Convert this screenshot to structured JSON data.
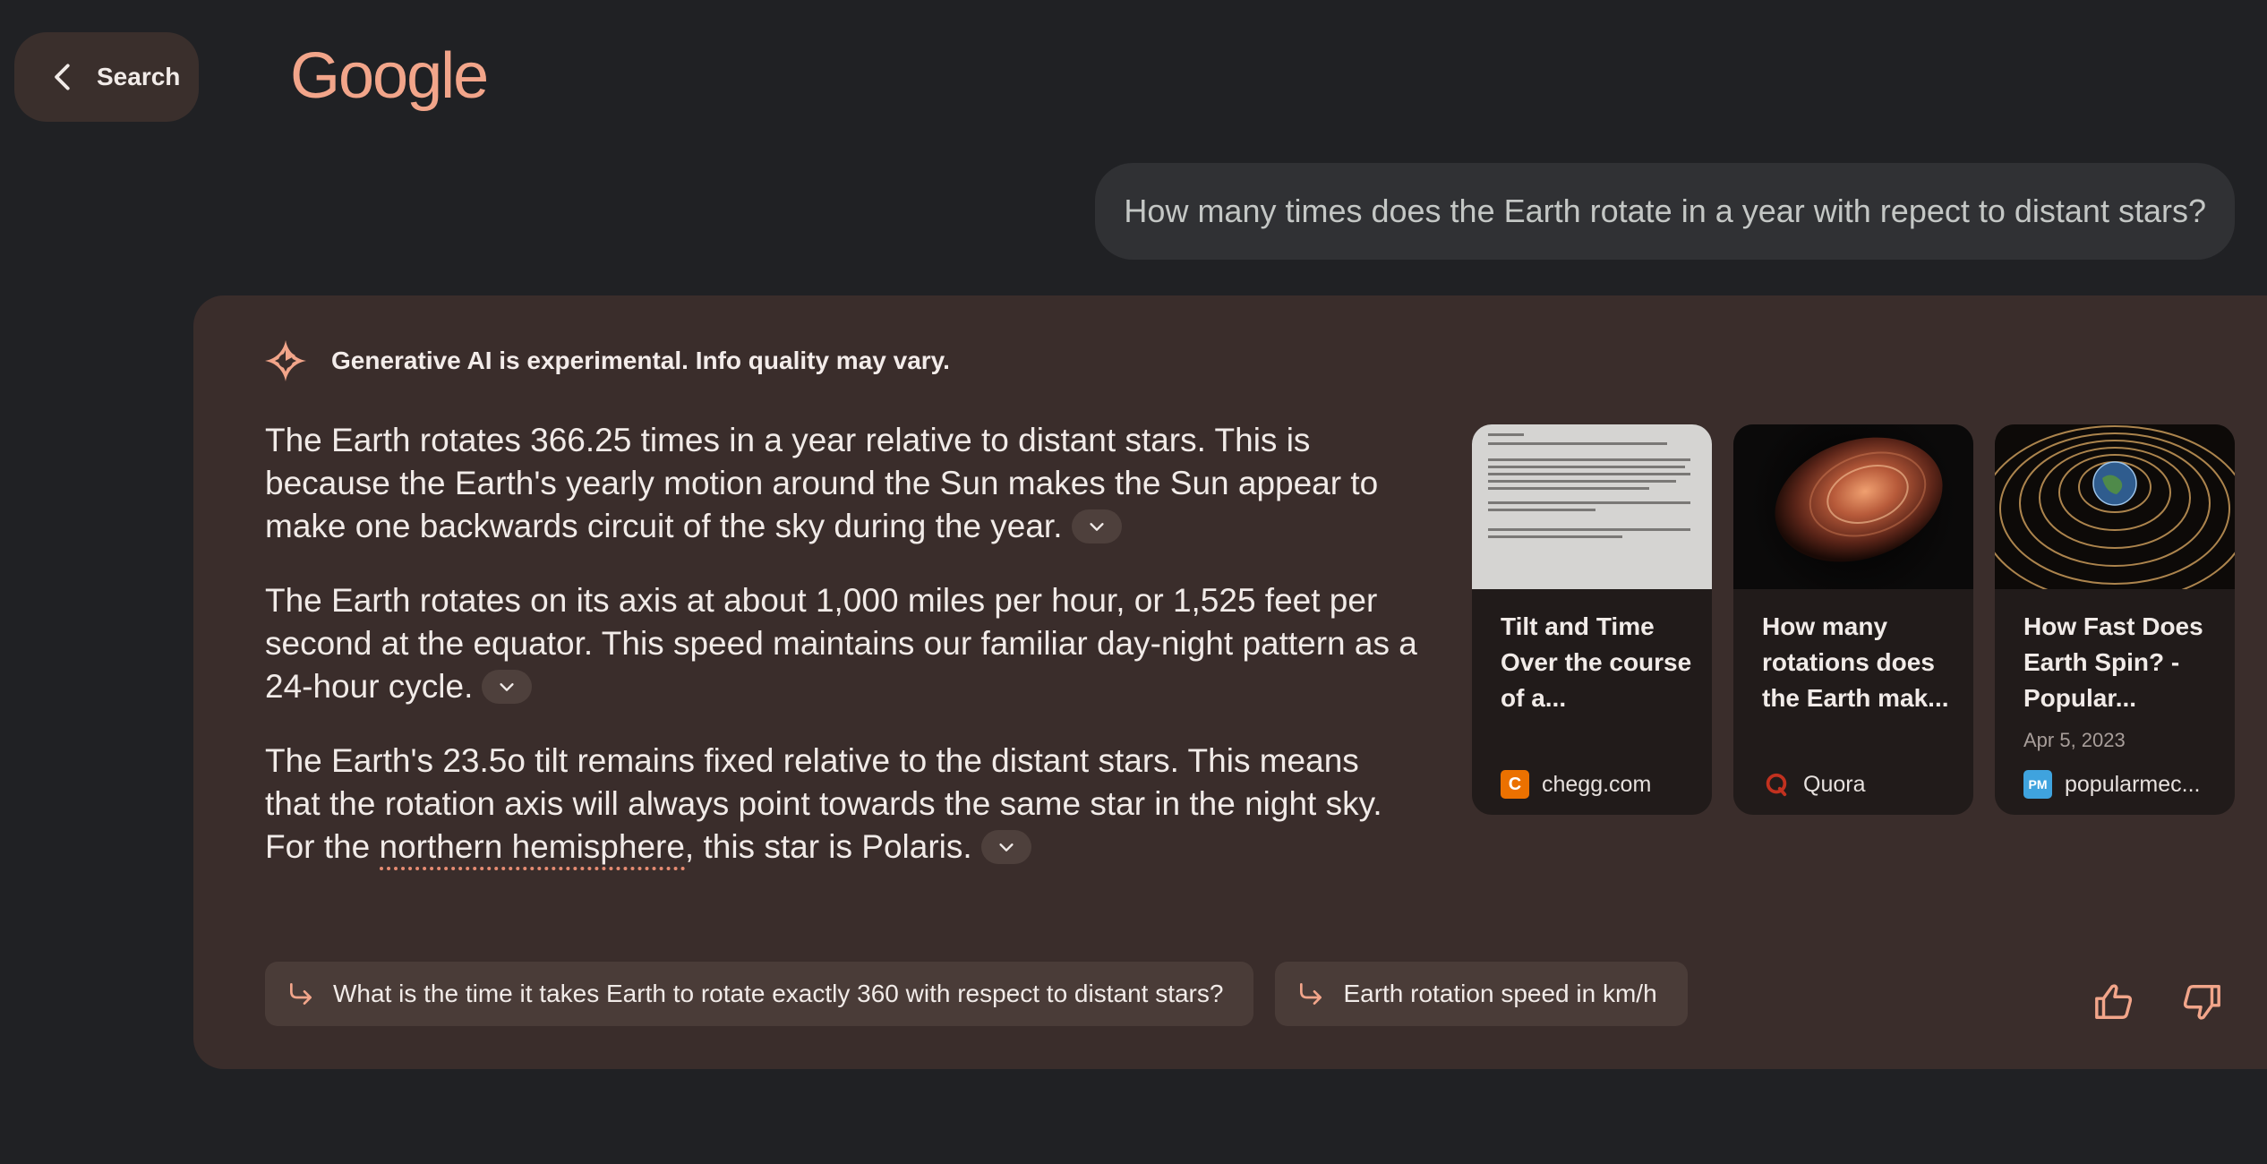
{
  "header": {
    "back_label": "Search",
    "logo_text": "Google"
  },
  "query": {
    "text": "How many times does the Earth rotate in a year with repect to distant stars?"
  },
  "ai_panel": {
    "disclaimer": "Generative AI is experimental. Info quality may vary.",
    "paragraphs": [
      {
        "text": "The Earth rotates 366.25 times in a year relative to distant stars. This is because the Earth's yearly motion around the Sun makes the Sun appear to make one backwards circuit of the sky during the year."
      },
      {
        "text": "The Earth rotates on its axis at about 1,000 miles per hour, or 1,525 feet per second at the equator. This speed maintains our familiar day-night pattern as a 24-hour cycle."
      },
      {
        "text_before": "The Earth's 23.5o tilt remains fixed relative to the distant stars. This means that the rotation axis will always point towards the same star in the night sky. For the ",
        "link": "northern hemisphere",
        "text_after": ", this star is Polaris."
      }
    ],
    "sources": [
      {
        "title": "Tilt and Time Over the course of a...",
        "date": "",
        "site": "chegg.com",
        "favicon_letter": "C",
        "icon": "chegg-favicon"
      },
      {
        "title": "How many rotations does the Earth mak...",
        "date": "",
        "site": "Quora",
        "favicon_letter": "",
        "icon": "quora-favicon"
      },
      {
        "title": "How Fast Does Earth Spin? - Popular...",
        "date": "Apr 5, 2023",
        "site": "popularmec...",
        "favicon_letter": "PM",
        "icon": "popular-mechanics-favicon"
      }
    ],
    "followups": [
      {
        "label": "What is the time it takes Earth to rotate exactly 360 with respect to distant stars?"
      },
      {
        "label": "Earth rotation speed in km/h"
      }
    ]
  },
  "colors": {
    "page_bg": "#202124",
    "panel_bg": "#3a2d2b",
    "accent": "#f2a58a",
    "card_bg": "#211b1a"
  }
}
